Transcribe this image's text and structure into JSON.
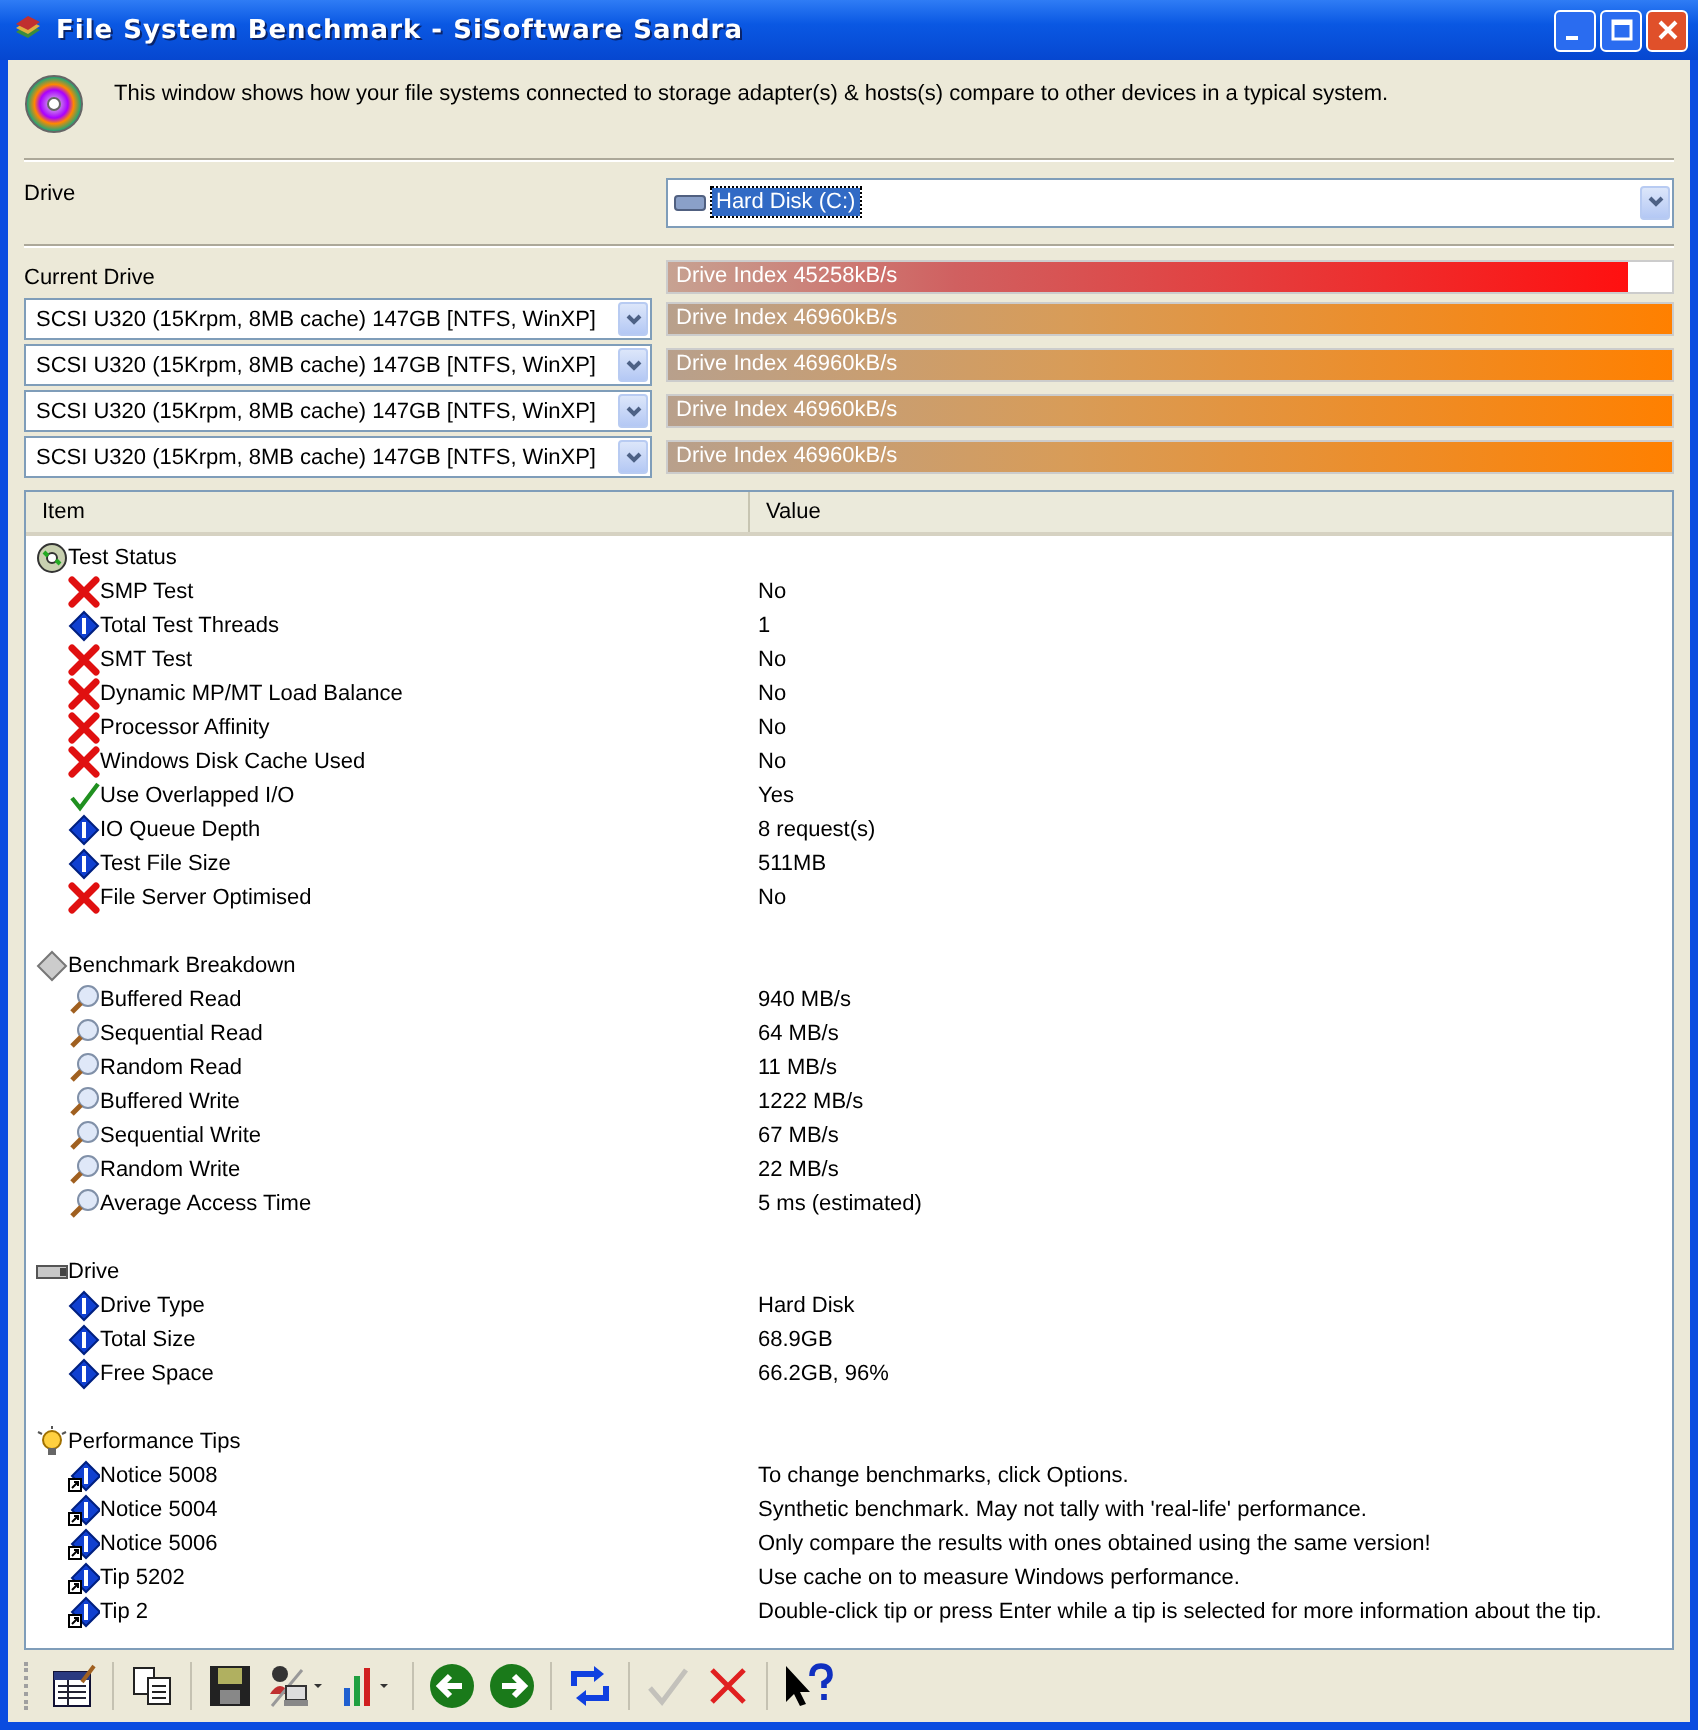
{
  "window": {
    "title": "File System Benchmark - SiSoftware Sandra"
  },
  "description": "This window shows how your file systems connected to storage adapter(s) & hosts(s) compare to other devices in a typical system.",
  "drive": {
    "label": "Drive",
    "value": "Hard Disk (C:)"
  },
  "current_drive": {
    "label": "Current Drive",
    "bar_text": "Drive Index 45258kB/s",
    "level": 0.957
  },
  "comparisons": [
    {
      "device": "SCSI U320 (15Krpm, 8MB cache) 147GB [NTFS, WinXP]",
      "bar_text": "Drive Index 46960kB/s",
      "level": 1
    },
    {
      "device": "SCSI U320 (15Krpm, 8MB cache) 147GB [NTFS, WinXP]",
      "bar_text": "Drive Index 46960kB/s",
      "level": 1
    },
    {
      "device": "SCSI U320 (15Krpm, 8MB cache) 147GB [NTFS, WinXP]",
      "bar_text": "Drive Index 46960kB/s",
      "level": 1
    },
    {
      "device": "SCSI U320 (15Krpm, 8MB cache) 147GB [NTFS, WinXP]",
      "bar_text": "Drive Index 46960kB/s",
      "level": 1
    }
  ],
  "table": {
    "columns": [
      "Item",
      "Value"
    ],
    "sections": [
      {
        "label": "Test Status",
        "kind": "status",
        "children": [
          {
            "label": "SMP Test",
            "value": "No",
            "kind": "fail"
          },
          {
            "label": "Total Test Threads",
            "value": "1",
            "kind": "info"
          },
          {
            "label": "SMT Test",
            "value": "No",
            "kind": "fail"
          },
          {
            "label": "Dynamic MP/MT Load Balance",
            "value": "No",
            "kind": "fail"
          },
          {
            "label": "Processor Affinity",
            "value": "No",
            "kind": "fail"
          },
          {
            "label": "Windows Disk Cache Used",
            "value": "No",
            "kind": "fail"
          },
          {
            "label": "Use Overlapped I/O",
            "value": "Yes",
            "kind": "pass"
          },
          {
            "label": "IO Queue Depth",
            "value": "8 request(s)",
            "kind": "info"
          },
          {
            "label": "Test File Size",
            "value": "511MB",
            "kind": "info"
          },
          {
            "label": "File Server Optimised",
            "value": "No",
            "kind": "fail"
          }
        ]
      },
      {
        "label": "Benchmark Breakdown",
        "kind": "breakdown",
        "children": [
          {
            "label": "Buffered Read",
            "value": "940 MB/s",
            "kind": "result"
          },
          {
            "label": "Sequential Read",
            "value": "64 MB/s",
            "kind": "result"
          },
          {
            "label": "Random Read",
            "value": "11 MB/s",
            "kind": "result"
          },
          {
            "label": "Buffered Write",
            "value": "1222 MB/s",
            "kind": "result"
          },
          {
            "label": "Sequential Write",
            "value": "67 MB/s",
            "kind": "result"
          },
          {
            "label": "Random Write",
            "value": "22 MB/s",
            "kind": "result"
          },
          {
            "label": "Average Access Time",
            "value": "5 ms (estimated)",
            "kind": "result"
          }
        ]
      },
      {
        "label": "Drive",
        "kind": "drive",
        "children": [
          {
            "label": "Drive Type",
            "value": "Hard Disk",
            "kind": "info"
          },
          {
            "label": "Total Size",
            "value": "68.9GB",
            "kind": "info"
          },
          {
            "label": "Free Space",
            "value": "66.2GB, 96%",
            "kind": "info"
          }
        ]
      },
      {
        "label": "Performance Tips",
        "kind": "tips",
        "children": [
          {
            "label": "Notice 5008",
            "value": "To change benchmarks, click Options.",
            "kind": "tip"
          },
          {
            "label": "Notice 5004",
            "value": "Synthetic benchmark. May not tally with 'real-life' performance.",
            "kind": "tip"
          },
          {
            "label": "Notice 5006",
            "value": "Only compare the results with ones obtained using the same version!",
            "kind": "tip"
          },
          {
            "label": "Tip 5202",
            "value": "Use cache on to measure Windows performance.",
            "kind": "tip"
          },
          {
            "label": "Tip 2",
            "value": "Double-click tip or press Enter while a tip is selected for more information about the tip.",
            "kind": "tip"
          }
        ]
      }
    ]
  },
  "toolbar": [
    {
      "kind": "report",
      "disabled": false
    },
    {
      "kind": "copy",
      "disabled": false
    },
    {
      "kind": "save",
      "disabled": false
    },
    {
      "kind": "user",
      "disabled": false
    },
    {
      "kind": "chart",
      "disabled": false
    },
    {
      "kind": "back",
      "disabled": false
    },
    {
      "kind": "forward",
      "disabled": false
    },
    {
      "kind": "refresh",
      "disabled": false
    },
    {
      "kind": "ok",
      "disabled": true
    },
    {
      "kind": "cancel",
      "disabled": false
    },
    {
      "kind": "help",
      "disabled": false
    }
  ]
}
